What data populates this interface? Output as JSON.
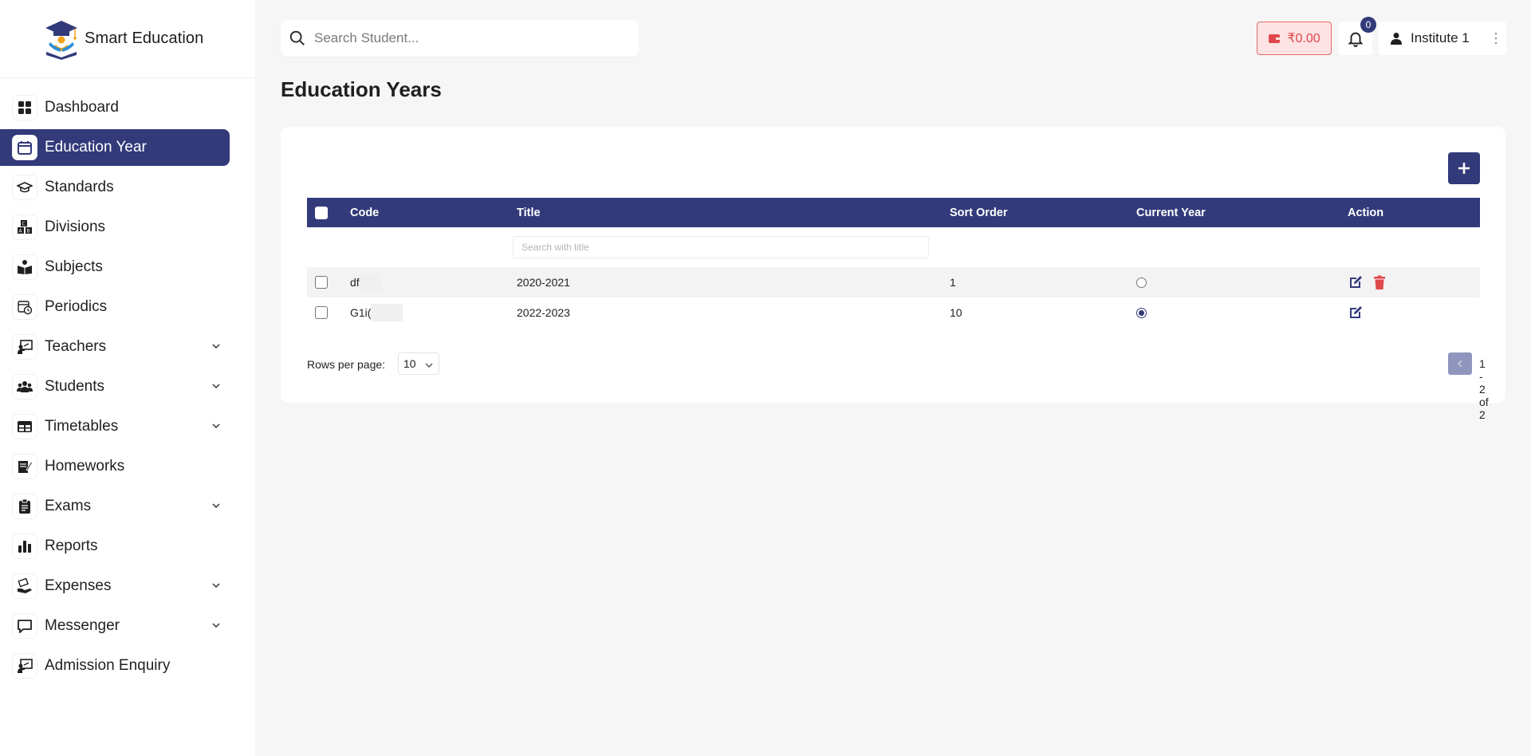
{
  "brand": {
    "name": "Smart Education"
  },
  "sidebar": {
    "items": [
      {
        "label": "Dashboard",
        "icon": "dashboard-icon",
        "expandable": false,
        "active": false
      },
      {
        "label": "Education Year",
        "icon": "calendar-icon",
        "expandable": false,
        "active": true
      },
      {
        "label": "Standards",
        "icon": "graduation-cap-icon",
        "expandable": false,
        "active": false
      },
      {
        "label": "Divisions",
        "icon": "abc-blocks-icon",
        "expandable": false,
        "active": false
      },
      {
        "label": "Subjects",
        "icon": "book-reader-icon",
        "expandable": false,
        "active": false
      },
      {
        "label": "Periodics",
        "icon": "calendar-clock-icon",
        "expandable": false,
        "active": false
      },
      {
        "label": "Teachers",
        "icon": "teacher-board-icon",
        "expandable": true,
        "active": false
      },
      {
        "label": "Students",
        "icon": "students-group-icon",
        "expandable": true,
        "active": false
      },
      {
        "label": "Timetables",
        "icon": "table-icon",
        "expandable": true,
        "active": false
      },
      {
        "label": "Homeworks",
        "icon": "homework-note-icon",
        "expandable": false,
        "active": false
      },
      {
        "label": "Exams",
        "icon": "clipboard-icon",
        "expandable": true,
        "active": false
      },
      {
        "label": "Reports",
        "icon": "bar-chart-icon",
        "expandable": false,
        "active": false
      },
      {
        "label": "Expenses",
        "icon": "money-hand-icon",
        "expandable": true,
        "active": false
      },
      {
        "label": "Messenger",
        "icon": "message-icon",
        "expandable": true,
        "active": false
      },
      {
        "label": "Admission Enquiry",
        "icon": "teacher-board-icon",
        "expandable": false,
        "active": false
      }
    ]
  },
  "topbar": {
    "search_placeholder": "Search Student...",
    "wallet_amount": "₹0.00",
    "notification_count": "0",
    "user_name": "Institute 1"
  },
  "page": {
    "title": "Education Years"
  },
  "table": {
    "headers": {
      "code": "Code",
      "title": "Title",
      "sort_order": "Sort Order",
      "current_year": "Current Year",
      "action": "Action"
    },
    "title_filter_placeholder": "Search with title",
    "rows": [
      {
        "code": "df",
        "title": "2020-2021",
        "sort_order": "1",
        "current_year": false,
        "can_delete": true
      },
      {
        "code": "G1i(",
        "title": "2022-2023",
        "sort_order": "10",
        "current_year": true,
        "can_delete": false
      }
    ]
  },
  "pagination": {
    "rows_per_page_label": "Rows per page:",
    "rows_per_page_value": "10",
    "range_text": "1 - 2 of 2"
  },
  "colors": {
    "primary": "#323a7a",
    "danger": "#e0474c",
    "wallet_bg": "#fde3e3"
  }
}
